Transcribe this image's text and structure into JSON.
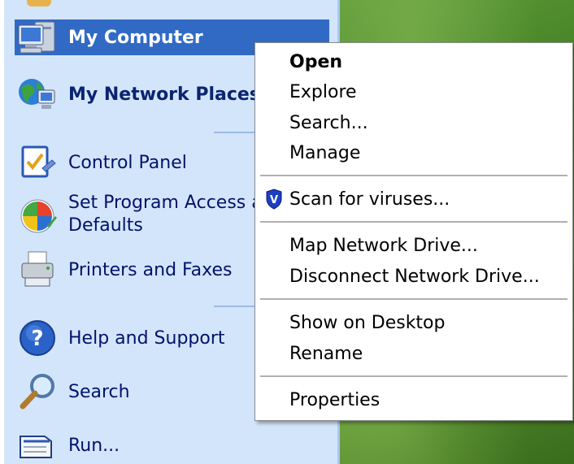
{
  "start_menu": {
    "items": [
      {
        "label": "My Computer",
        "icon": "my-computer-icon"
      },
      {
        "label": "My Network Places",
        "icon": "network-places-icon"
      },
      {
        "label": "Control Panel",
        "icon": "control-panel-icon"
      },
      {
        "label_line1": "Set Program Access a",
        "label_line2": "Defaults",
        "icon": "set-program-access-icon"
      },
      {
        "label": "Printers and Faxes",
        "icon": "printer-icon"
      },
      {
        "label": "Help and Support",
        "icon": "help-icon"
      },
      {
        "label": "Search",
        "icon": "search-icon"
      },
      {
        "label": "Run...",
        "icon": "run-icon"
      }
    ],
    "highlight_color": "#316ac5",
    "background_color": "#d3e5fa"
  },
  "context_menu": {
    "items": [
      {
        "label": "Open",
        "default": true
      },
      {
        "label": "Explore"
      },
      {
        "label": "Search..."
      },
      {
        "label": "Manage"
      },
      {
        "label": "Scan for viruses...",
        "icon": "antivirus-shield-icon"
      },
      {
        "label": "Map Network Drive..."
      },
      {
        "label": "Disconnect Network Drive..."
      },
      {
        "label": "Show on Desktop"
      },
      {
        "label": "Rename"
      },
      {
        "label": "Properties"
      }
    ]
  }
}
